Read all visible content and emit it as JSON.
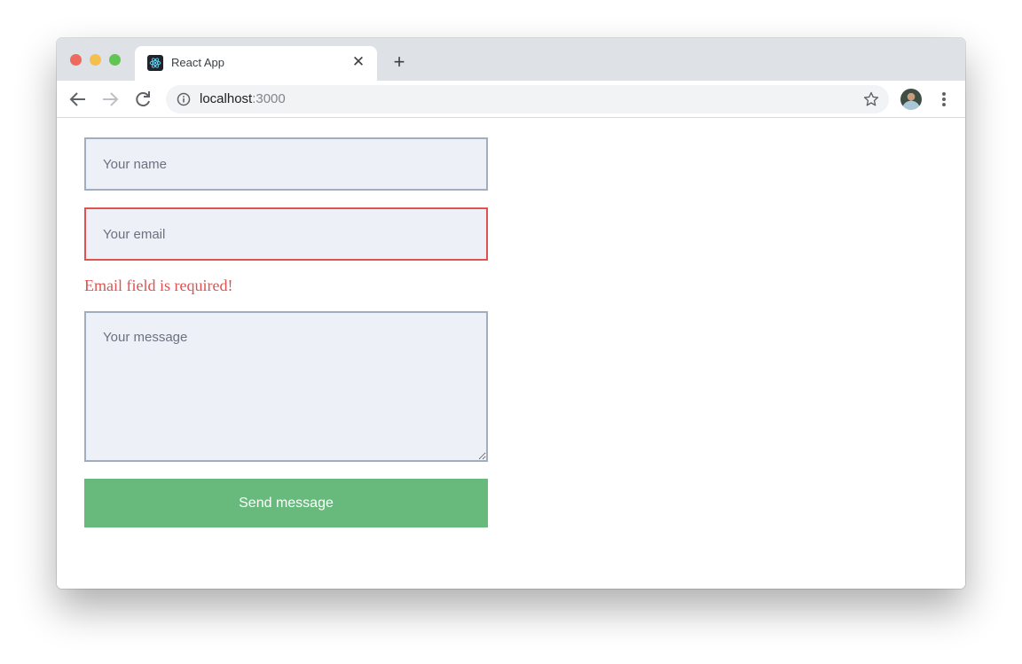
{
  "browser": {
    "tab": {
      "title": "React App",
      "favicon": "react-logo-icon",
      "close_icon": "close-icon"
    },
    "new_tab_icon": "plus-icon",
    "nav": {
      "back_icon": "arrow-left-icon",
      "forward_icon": "arrow-right-icon",
      "reload_icon": "reload-icon"
    },
    "omnibox": {
      "info_icon": "info-icon",
      "host": "localhost",
      "port": ":3000",
      "bookmark_icon": "star-icon"
    },
    "profile_icon": "avatar",
    "menu_icon": "kebab-menu-icon"
  },
  "form": {
    "name": {
      "placeholder": "Your name",
      "value": ""
    },
    "email": {
      "placeholder": "Your email",
      "value": "",
      "error": "Email field is required!"
    },
    "message": {
      "placeholder": "Your message",
      "value": ""
    },
    "submit_label": "Send message"
  },
  "colors": {
    "error": "#e05252",
    "submit": "#68b97c",
    "field_bg": "#edf0f7",
    "field_border": "#a0aec0"
  }
}
